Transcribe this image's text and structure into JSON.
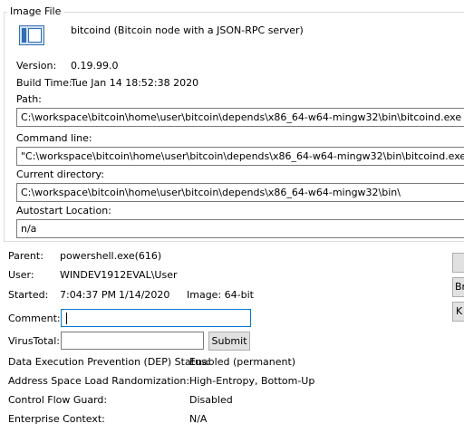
{
  "image_file": {
    "legend": "Image File",
    "description": "bitcoind (Bitcoin node with a JSON-RPC server)",
    "version_label": "Version:",
    "version_value": "0.19.99.0",
    "build_time_label": "Build Time:",
    "build_time_value": "Tue Jan 14 18:52:38 2020",
    "path_label": "Path:",
    "path_value": "C:\\workspace\\bitcoin\\home\\user\\bitcoin\\depends\\x86_64-w64-mingw32\\bin\\bitcoind.exe",
    "command_line_label": "Command line:",
    "command_line_value": "\"C:\\workspace\\bitcoin\\home\\user\\bitcoin\\depends\\x86_64-w64-mingw32\\bin\\bitcoind.exe\" -regtest",
    "current_directory_label": "Current directory:",
    "current_directory_value": "C:\\workspace\\bitcoin\\home\\user\\bitcoin\\depends\\x86_64-w64-mingw32\\bin\\",
    "autostart_label": "Autostart Location:",
    "autostart_value": "n/a",
    "icon": "application-window-icon"
  },
  "process": {
    "parent_label": "Parent:",
    "parent_value": "powershell.exe(616)",
    "user_label": "User:",
    "user_value": "WINDEV1912EVAL\\User",
    "started_label": "Started:",
    "started_time": "7:04:37 PM",
    "started_date": "1/14/2020",
    "image_label": "Image: 64-bit",
    "comment_label": "Comment:",
    "comment_value": "",
    "virustotal_label": "VirusTotal:",
    "virustotal_value": "",
    "submit_label": "Submit",
    "dep_label": "Data Execution Prevention (DEP) Status:",
    "dep_value": "Enabled (permanent)",
    "aslr_label": "Address Space Load Randomization:",
    "aslr_value": "High-Entropy, Bottom-Up",
    "cfg_label": "Control Flow Guard:",
    "cfg_value": "Disabled",
    "enterprise_label": "Enterprise Context:",
    "enterprise_value": "N/A"
  },
  "side_buttons": {
    "button1_label": "",
    "button2_label": "Br",
    "button3_label": "K"
  },
  "colors": {
    "focus_border": "#0078d7",
    "groupbox_border": "#dcdcdc",
    "button_face": "#e1e1e1"
  }
}
